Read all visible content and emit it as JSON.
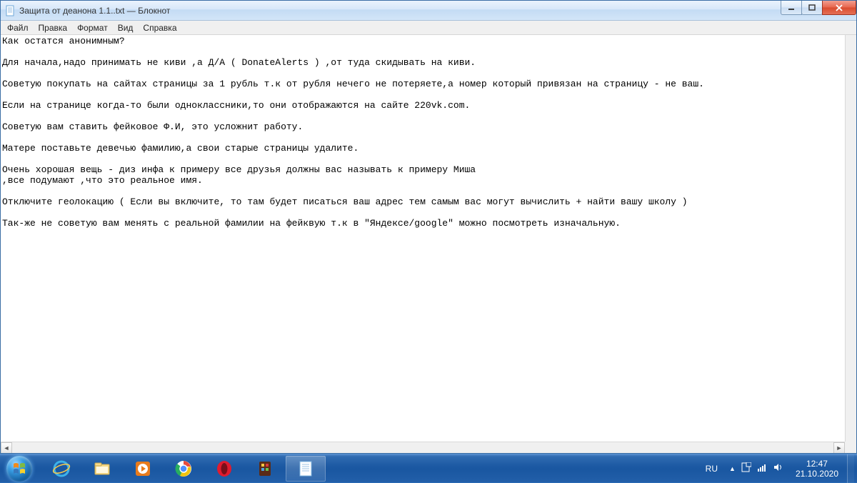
{
  "window": {
    "title": "Защита от деанона 1.1..txt — Блокнот"
  },
  "menu": {
    "file": "Файл",
    "edit": "Правка",
    "format": "Формат",
    "view": "Вид",
    "help": "Справка"
  },
  "content": "Как остатся анонимным?\n\nДля начала,надо принимать не киви ,а Д/А ( DonateAlerts ) ,от туда скидывать на киви.\n\nСоветую покупать на сайтах страницы за 1 рубль т.к от рубля нечего не потеряете,а номер который привязан на страницу - не ваш.\n\nЕсли на странице когда-то были одноклассники,то они отображаются на сайте 220vk.com.\n\nСоветую вам ставить фейковое Ф.И, это усложнит работу.\n\nМатере поставьте девечью фамилию,а свои старые страницы удалите.\n\nОчень хорошая вещь - диз инфа к примеру все друзья должны вас называть к примеру Миша\n,все подумают ,что это реальное имя.\n\nОтключите геолокацию ( Если вы включите, то там будет писаться ваш адрес тем самым вас могут вычислить + найти вашу школу )\n\nТак-же не советую вам менять с реальной фамилии на фейквую т.к в \"Яндексе/google\" можно посмотреть изначальную.",
  "tray": {
    "lang": "RU",
    "time": "12:47",
    "date": "21.10.2020"
  }
}
